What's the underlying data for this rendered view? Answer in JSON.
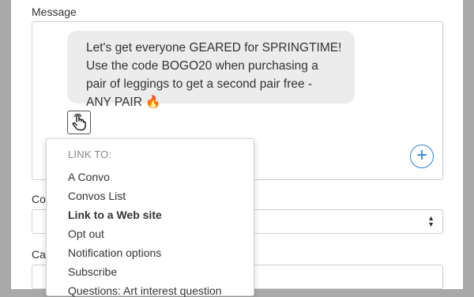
{
  "message": {
    "label": "Message",
    "lines": [
      "Let's get everyone GEARED for SPRINGTIME!",
      "Use the code BOGO20 when purchasing a",
      "pair of leggings to get a second pair free -",
      "ANY PAIR 🔥"
    ],
    "add_button_glyph": "+"
  },
  "field_labels": {
    "second": "Co",
    "third": "Ca"
  },
  "link_menu": {
    "header": "LINK TO:",
    "items": [
      "A Convo",
      "Convos List",
      "Link to a Web site",
      "Opt out",
      "Notification options",
      "Subscribe",
      "Questions: Art interest question"
    ]
  },
  "select_arrows": "▲\n▼"
}
